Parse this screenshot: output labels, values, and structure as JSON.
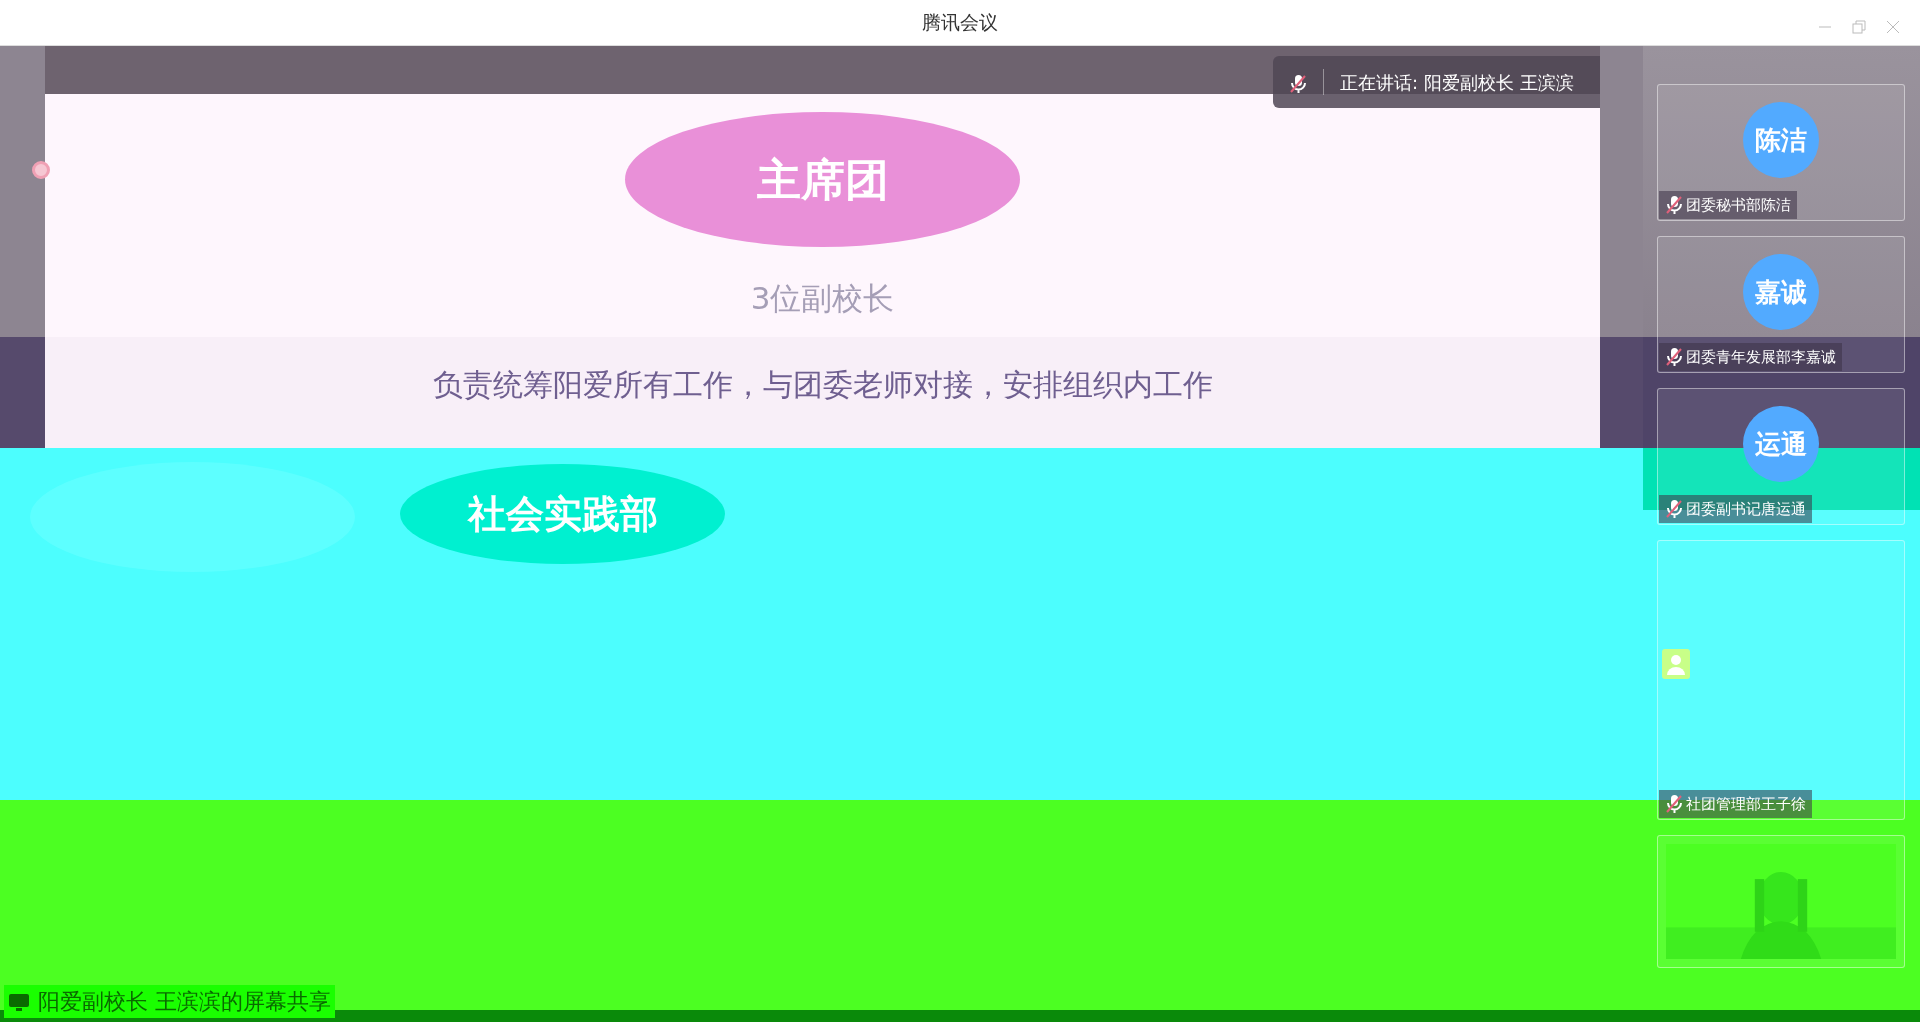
{
  "window": {
    "title": "腾讯会议"
  },
  "speaker_banner": {
    "text": "正在讲话: 阳爱副校长 王滨滨",
    "muted": true
  },
  "slide": {
    "heading": "主席团",
    "subtitle": "3位副校长",
    "description": "负责统筹阳爱所有工作，与团委老师对接，安排组织内工作",
    "next_heading": "社会实践部"
  },
  "participants": [
    {
      "kind": "avatar",
      "avatar": "陈洁",
      "name": "团委秘书部陈洁",
      "muted": true
    },
    {
      "kind": "avatar",
      "avatar": "嘉诚",
      "name": "团委青年发展部李嘉诚",
      "muted": true
    },
    {
      "kind": "avatar",
      "avatar": "运通",
      "name": "团委副书记唐运通",
      "muted": true
    },
    {
      "kind": "camera-off",
      "name": "社团管理部王子徐",
      "muted": true
    },
    {
      "kind": "video"
    }
  ],
  "share_label": "阳爱副校长 王滨滨的屏幕共享"
}
